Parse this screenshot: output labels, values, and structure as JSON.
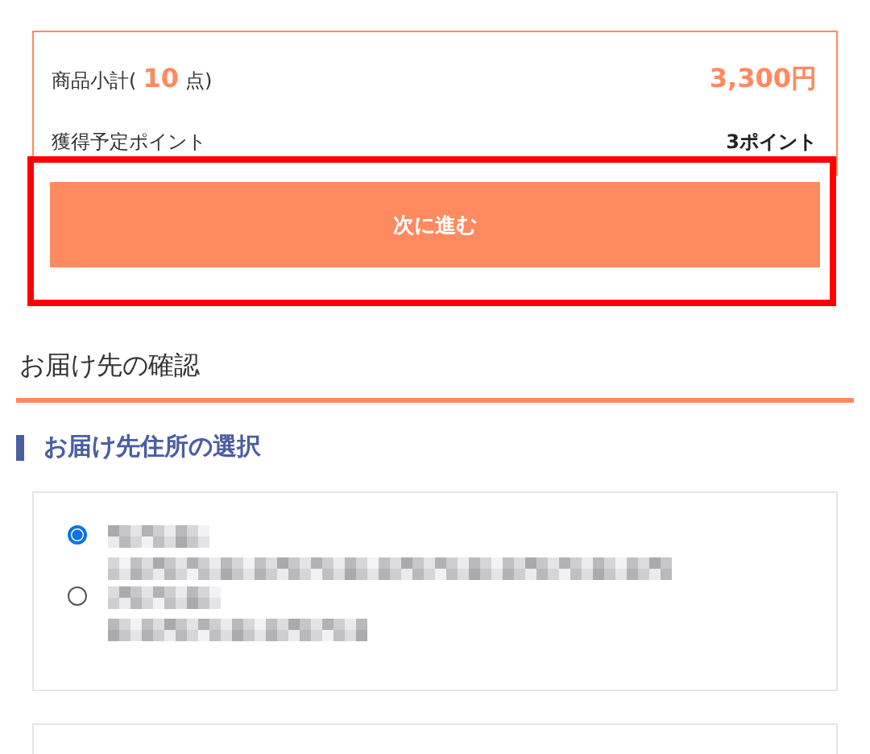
{
  "summary": {
    "subtotal_label_before": "商品小計(",
    "subtotal_count": "10",
    "subtotal_label_after": "点)",
    "subtotal_amount": "3,300円",
    "points_label": "獲得予定ポイント",
    "points_value": "3ポイント"
  },
  "next_button": {
    "label": "次に進む",
    "highlighted": true
  },
  "section_title": "お届け先の確認",
  "subsection_title": "お届け先住所の選択",
  "addresses": [
    {
      "selected": true
    },
    {
      "selected": false
    }
  ]
}
